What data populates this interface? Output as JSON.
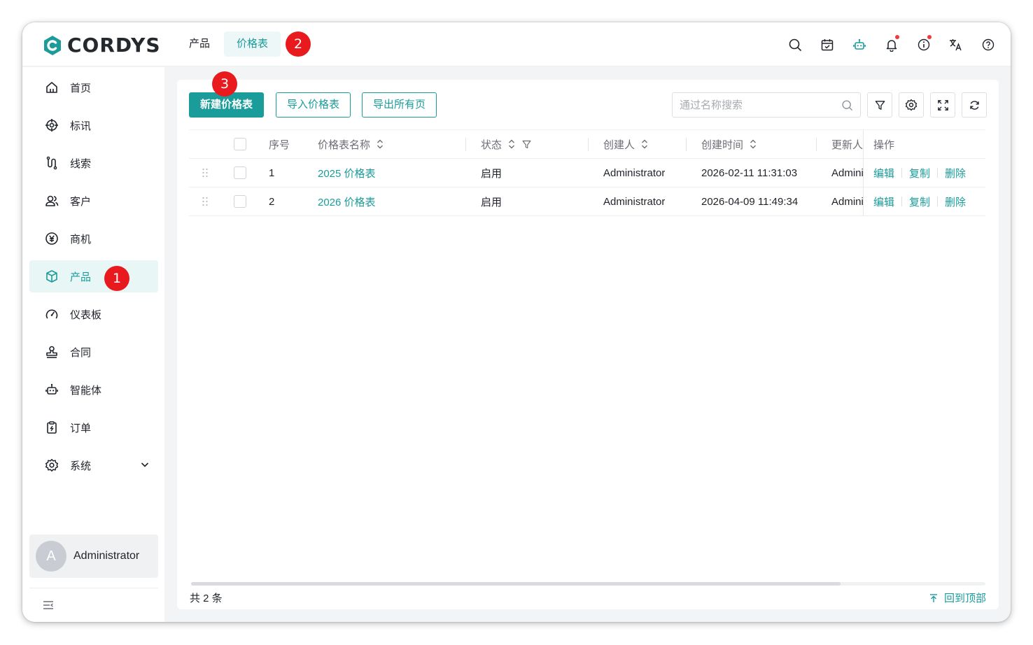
{
  "app": {
    "logo_text": "CORDYS",
    "brand_color": "#1a9c9a"
  },
  "header": {
    "tabs": [
      {
        "label": "产品",
        "active": false
      },
      {
        "label": "价格表",
        "active": true
      }
    ],
    "icons": [
      "search-icon",
      "calendar-icon",
      "robot-icon",
      "bell-icon",
      "info-icon",
      "translate-icon",
      "help-icon"
    ]
  },
  "sidebar": {
    "items": [
      {
        "label": "首页",
        "icon": "home-icon"
      },
      {
        "label": "标讯",
        "icon": "target-icon"
      },
      {
        "label": "线索",
        "icon": "clue-icon"
      },
      {
        "label": "客户",
        "icon": "customer-icon"
      },
      {
        "label": "商机",
        "icon": "yen-icon"
      },
      {
        "label": "产品",
        "icon": "box-icon",
        "active": true
      },
      {
        "label": "仪表板",
        "icon": "gauge-icon"
      },
      {
        "label": "合同",
        "icon": "stamp-icon"
      },
      {
        "label": "智能体",
        "icon": "robot-icon"
      },
      {
        "label": "订单",
        "icon": "order-icon"
      },
      {
        "label": "系统",
        "icon": "gear-icon"
      }
    ],
    "user": {
      "avatar_letter": "A",
      "name": "Administrator"
    }
  },
  "annotations": {
    "sidebar_product": "1",
    "tab_pricelist": "2",
    "new_button": "3"
  },
  "toolbar": {
    "new_label": "新建价格表",
    "import_label": "导入价格表",
    "export_label": "导出所有页",
    "search_placeholder": "通过名称搜索"
  },
  "table": {
    "columns": [
      "序号",
      "价格表名称",
      "状态",
      "创建人",
      "创建时间",
      "更新人",
      "操作"
    ],
    "rows": [
      {
        "index": "1",
        "name": "2025 价格表",
        "status": "启用",
        "creator": "Administrator",
        "created_at": "2026-02-11 11:31:03",
        "updater": "Administrator"
      },
      {
        "index": "2",
        "name": "2026 价格表",
        "status": "启用",
        "creator": "Administrator",
        "created_at": "2026-04-09 11:49:34",
        "updater": "Administrator"
      }
    ],
    "actions": {
      "edit": "编辑",
      "copy": "复制",
      "delete": "删除"
    }
  },
  "footer": {
    "total": "共 2 条",
    "back_to_top": "回到顶部"
  }
}
